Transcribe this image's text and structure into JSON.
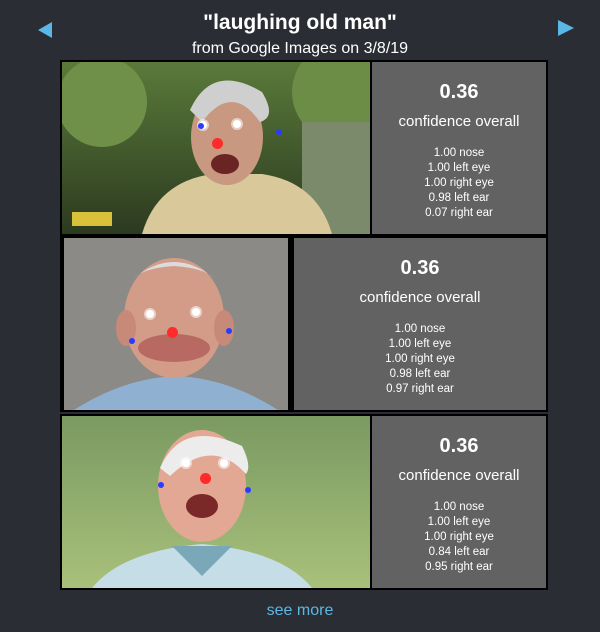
{
  "header": {
    "title": "\"laughing old man\"",
    "subtitle": "from Google Images on 3/8/19"
  },
  "results": [
    {
      "score": "0.36",
      "confidence_label": "confidence overall",
      "parts": [
        "1.00 nose",
        "1.00 left eye",
        "1.00 right eye",
        "0.98 left ear",
        "0.07 right ear"
      ]
    },
    {
      "score": "0.36",
      "confidence_label": "confidence overall",
      "parts": [
        "1.00 nose",
        "1.00 left eye",
        "1.00 right eye",
        "0.98 left ear",
        "0.97 right ear"
      ]
    },
    {
      "score": "0.36",
      "confidence_label": "confidence overall",
      "parts": [
        "1.00 nose",
        "1.00 left eye",
        "1.00 right eye",
        "0.84 left ear",
        "0.95 right ear"
      ]
    }
  ],
  "footer": {
    "see_more": "see more"
  },
  "colors": {
    "accent": "#5bb8e6",
    "panel": "#626262",
    "background": "#2a2d33",
    "nose_point": "#ff2a2a",
    "eye_point": "#ffffff",
    "ear_point": "#2a3bff"
  },
  "icons": {
    "prev": "triangle-left-icon",
    "next": "triangle-right-icon"
  }
}
